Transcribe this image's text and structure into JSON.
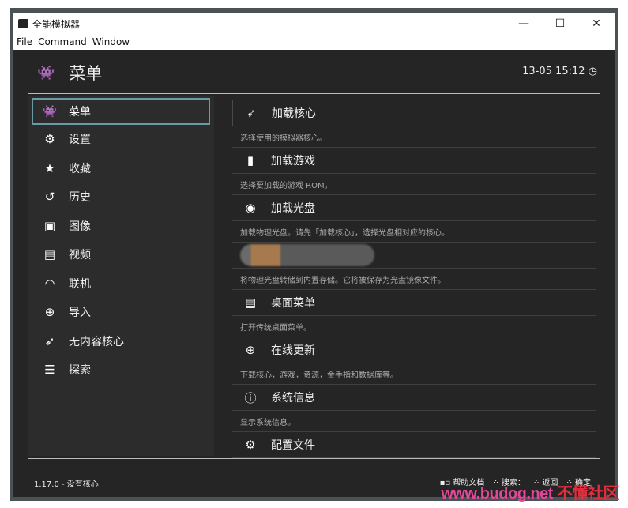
{
  "window": {
    "title": "全能模拟器",
    "menus": [
      "File",
      "Command",
      "Window"
    ],
    "controls": [
      "—",
      "☐",
      "✕"
    ]
  },
  "header": {
    "title": "菜单",
    "clock": "13-05 15:12"
  },
  "sidebar": {
    "items": [
      {
        "label": "菜单",
        "icon": "invader-icon"
      },
      {
        "label": "设置",
        "icon": "gear-icon"
      },
      {
        "label": "收藏",
        "icon": "star-icon"
      },
      {
        "label": "历史",
        "icon": "history-icon"
      },
      {
        "label": "图像",
        "icon": "image-icon"
      },
      {
        "label": "视频",
        "icon": "film-icon"
      },
      {
        "label": "联机",
        "icon": "netplay-icon"
      },
      {
        "label": "导入",
        "icon": "plus-icon"
      },
      {
        "label": "无内容核心",
        "icon": "rocket-icon"
      },
      {
        "label": "探索",
        "icon": "database-icon"
      }
    ]
  },
  "main": {
    "items": [
      {
        "label": "加载核心",
        "desc": "选择使用的模拟器核心。",
        "icon": "rocket-icon"
      },
      {
        "label": "加载游戏",
        "desc": "选择要加载的游戏 ROM。",
        "icon": "file-icon"
      },
      {
        "label": "加载光盘",
        "desc": "加载物理光盘。请先「加载核心」，选择光盘相对应的核心。",
        "icon": "disc-icon"
      },
      {
        "label": "",
        "desc": "将物理光盘转储到内置存储。它将被保存为光盘镜像文件。",
        "icon": "dump-icon"
      },
      {
        "label": "桌面菜单",
        "desc": "打开传统桌面菜单。",
        "icon": "menu-icon"
      },
      {
        "label": "在线更新",
        "desc": "下载核心，游戏，资源，金手指和数据库等。",
        "icon": "globe-icon"
      },
      {
        "label": "系统信息",
        "desc": "显示系统信息。",
        "icon": "info-icon"
      },
      {
        "label": "配置文件",
        "desc": "",
        "icon": "gears-icon"
      }
    ]
  },
  "footer": {
    "version": "1.17.0 - 没有核心",
    "buttons": [
      "帮助文档",
      "搜索：",
      "返回",
      "确定"
    ]
  },
  "watermark": {
    "site": "www.budog.net",
    "name": "不懂社区"
  }
}
